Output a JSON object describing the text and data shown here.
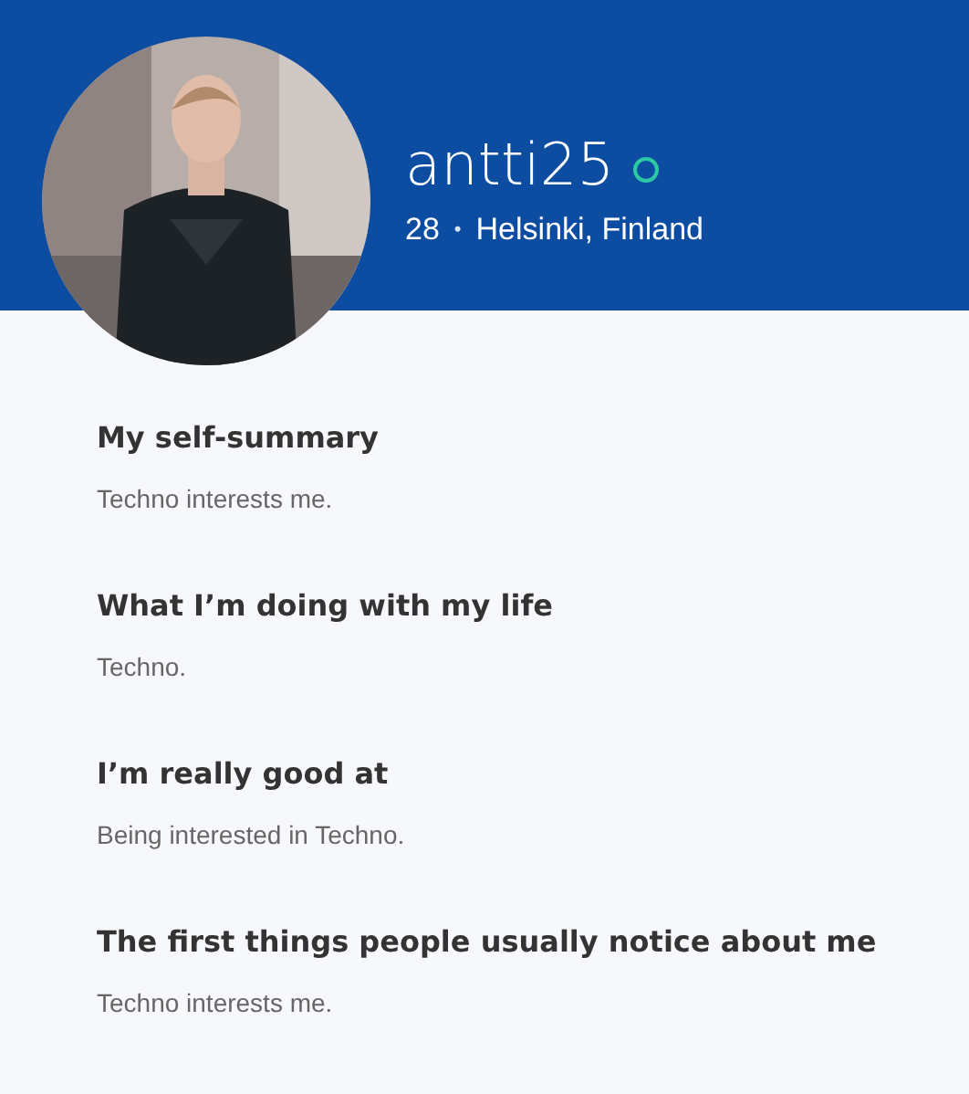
{
  "profile": {
    "username": "antti25",
    "online": true,
    "age": "28",
    "separator": "•",
    "location": "Helsinki, Finland"
  },
  "sections": [
    {
      "title": "My self-summary",
      "text": "Techno interests me."
    },
    {
      "title": "What I’m doing with my life",
      "text": "Techno."
    },
    {
      "title": "I’m really good at",
      "text": "Being interested in Techno."
    },
    {
      "title": "The first things people usually notice about me",
      "text": "Techno interests me."
    }
  ]
}
